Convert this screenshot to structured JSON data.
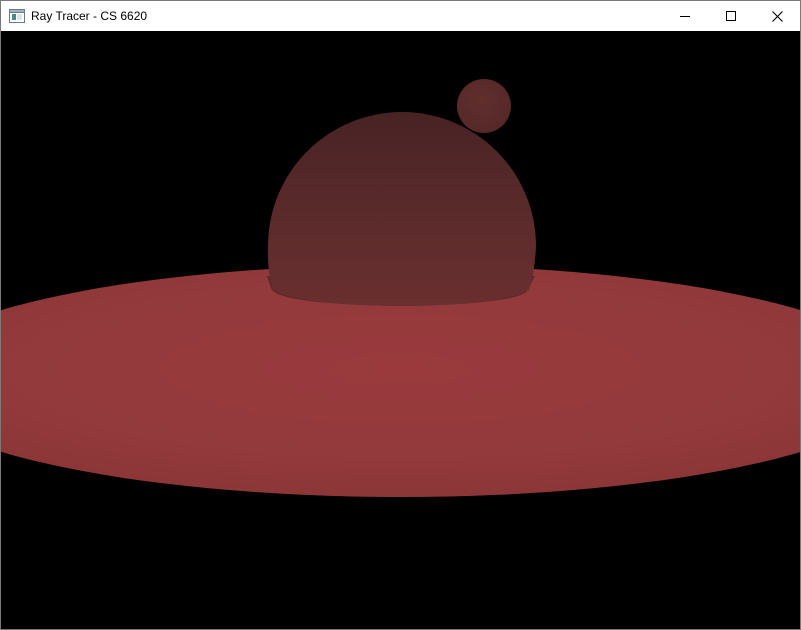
{
  "window": {
    "title": "Ray Tracer - CS 6620",
    "app_icon": "window-app-icon",
    "controls": {
      "minimize_icon": "minimize-icon",
      "maximize_icon": "maximize-icon",
      "close_icon": "close-icon"
    }
  },
  "scene": {
    "background_color": "#000000",
    "plane_color": "#9a3a3d",
    "large_sphere_color": "#5e2b2b",
    "small_sphere_color": "#5c2b2b"
  }
}
